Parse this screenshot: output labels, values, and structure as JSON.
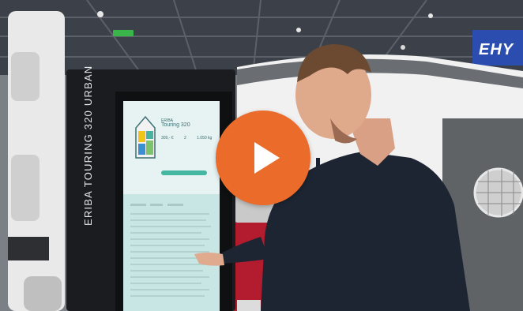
{
  "video": {
    "play_button_color": "#ea6b2a"
  },
  "scene": {
    "kiosk_vertical_label": "ERIBA TOURING 320 URBAN",
    "booth_sign_text": "EHY",
    "screen": {
      "brand": "ERIBA",
      "model": "Touring 320",
      "stat_price": "309,- €",
      "stat_seats": "2",
      "stat_weight": "1.050 kg"
    }
  }
}
